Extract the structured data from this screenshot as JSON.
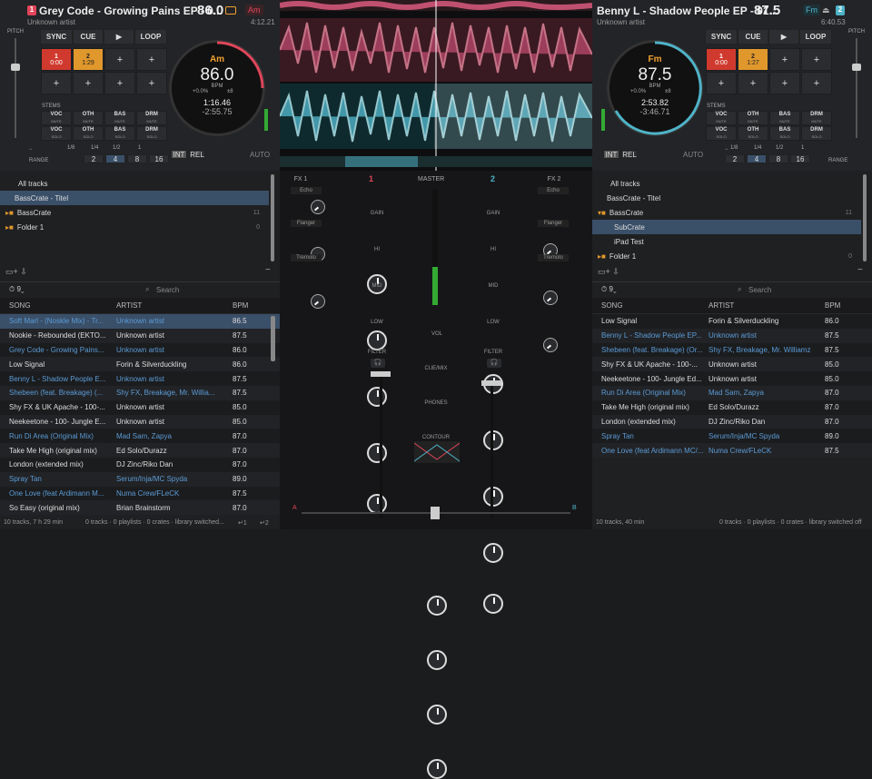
{
  "colors": {
    "left_accent": "#e0455a",
    "right_accent": "#4fb3c8",
    "key_orange": "#f0a030",
    "selection": "#3a4f68",
    "link_blue": "#5b9bd5",
    "pad_red": "#d03a2e",
    "pad_orange": "#e0982c"
  },
  "deck_left": {
    "num": "1",
    "title": "Grey Code - Growing Pains EP - 0...",
    "artist": "Unknown artist",
    "bpm": "86.0",
    "key": "Am",
    "duration": "4:12.21",
    "jog_key": "Am",
    "jog_bpm": "86.0",
    "jog_bpm_unit": "BPM",
    "jog_pitch": "+0.0%",
    "jog_range": "±8",
    "jog_elapsed": "1:16.46",
    "jog_remaining": "-2:55.75",
    "pitch_label": "PITCH",
    "sync": "SYNC",
    "cue": "CUE",
    "play": "▶",
    "loop": "LOOP",
    "hotcue1_num": "1",
    "hotcue1_time": "0:00",
    "hotcue2_num": "2",
    "hotcue2_time": "1:29",
    "plus": "+",
    "stems_label": "STEMS",
    "stems": [
      [
        "VOC",
        "MUTE"
      ],
      [
        "OTH",
        "MUTE"
      ],
      [
        "BAS",
        "MUTE"
      ],
      [
        "DRM",
        "MUTE"
      ],
      [
        "VOC",
        "SOLO"
      ],
      [
        "OTH",
        "SOLO"
      ],
      [
        "BAS",
        "SOLO"
      ],
      [
        "DRM",
        "SOLO"
      ]
    ],
    "loop_fracs": [
      "1/8",
      "1/4",
      "1/2",
      "1"
    ],
    "loop_vals": [
      "2",
      "4",
      "8",
      "16"
    ],
    "range": "RANGE",
    "int": "INT",
    "rel": "REL",
    "auto": "AUTO",
    "minus": "−"
  },
  "deck_right": {
    "num": "2",
    "title": "Benny L - Shadow People EP - 01...",
    "artist": "Unknown artist",
    "bpm": "87.5",
    "key": "Fm",
    "duration": "6:40.53",
    "jog_key": "Fm",
    "jog_bpm": "87.5",
    "jog_bpm_unit": "BPM",
    "jog_pitch": "+0.0%",
    "jog_range": "±8",
    "jog_elapsed": "2:53.82",
    "jog_remaining": "-3:46.71",
    "pitch_label": "PITCH",
    "sync": "SYNC",
    "cue": "CUE",
    "play": "▶",
    "loop": "LOOP",
    "hotcue1_num": "1",
    "hotcue1_time": "0:00",
    "hotcue2_num": "2",
    "hotcue2_time": "1:27",
    "plus": "+",
    "stems_label": "STEMS",
    "stems": [
      [
        "VOC",
        "MUTE"
      ],
      [
        "OTH",
        "MUTE"
      ],
      [
        "BAS",
        "MUTE"
      ],
      [
        "DRM",
        "MUTE"
      ],
      [
        "VOC",
        "SOLO"
      ],
      [
        "OTH",
        "SOLO"
      ],
      [
        "BAS",
        "SOLO"
      ],
      [
        "DRM",
        "SOLO"
      ]
    ],
    "loop_fracs": [
      "1/8",
      "1/4",
      "1/2",
      "1"
    ],
    "loop_vals": [
      "2",
      "4",
      "8",
      "16"
    ],
    "range": "RANGE",
    "int": "INT",
    "rel": "REL",
    "auto": "AUTO",
    "minus": "−"
  },
  "library_left": {
    "tree": [
      {
        "label": "All tracks",
        "count": ""
      },
      {
        "label": "BassCrate - Titel",
        "count": ""
      },
      {
        "label": "BassCrate",
        "count": "11"
      },
      {
        "label": "Folder 1",
        "count": "0"
      }
    ],
    "search_placeholder": "Search",
    "history_count": "9",
    "col_song": "SONG",
    "col_artist": "ARTIST",
    "col_bpm": "BPM",
    "rows": [
      [
        "Soft Marl - (Noskle Mix) - Tr...",
        "Unknown artist",
        "86.5"
      ],
      [
        "Nookie - Rebounded (EKTO...",
        "Unknown artist",
        "87.5"
      ],
      [
        "Grey Code - Growing Pains...",
        "Unknown artist",
        "86.0"
      ],
      [
        "Low Signal",
        "Forin & Silverduckling",
        "86.0"
      ],
      [
        "Benny L - Shadow People E...",
        "Unknown artist",
        "87.5"
      ],
      [
        "Shebeen (feat. Breakage) (...",
        "Shy FX, Breakage, Mr. Willia...",
        "87.5"
      ],
      [
        "Shy FX & UK Apache - 100-...",
        "Unknown artist",
        "85.0"
      ],
      [
        "Neekeetone - 100- Jungle E...",
        "Unknown artist",
        "85.0"
      ],
      [
        "Run Di Area (Original Mix)",
        "Mad Sam, Zapya",
        "87.0"
      ],
      [
        "Take Me High (original mix)",
        "Ed Solo/Durazz",
        "87.0"
      ],
      [
        "London (extended mix)",
        "DJ Zinc/Riko Dan",
        "87.0"
      ],
      [
        "Spray Tan",
        "Serum/Inja/MC Spyda",
        "89.0"
      ],
      [
        "One Love (feat Ardimann M...",
        "Numa Crew/FLeCK",
        "87.5"
      ],
      [
        "So Easy (original mix)",
        "Brian Brainstorm",
        "87.0"
      ]
    ],
    "status": "10 tracks, 7 h 29 min",
    "status2": "0 tracks · 0 playlists · 0 crates · library switched...",
    "deck1": "↵1",
    "deck2": "↵2"
  },
  "library_right": {
    "tree": [
      {
        "label": "All tracks",
        "count": ""
      },
      {
        "label": "BassCrate - Titel",
        "count": ""
      },
      {
        "label": "BassCrate",
        "count": "11"
      },
      {
        "label": "SubCrate",
        "count": ""
      },
      {
        "label": "iPad Test",
        "count": ""
      },
      {
        "label": "Folder 1",
        "count": "0"
      }
    ],
    "search_placeholder": "Search",
    "history_count": "9",
    "col_song": "SONG",
    "col_artist": "ARTIST",
    "col_bpm": "BPM",
    "rows": [
      [
        "Low Signal",
        "Forin & Silverduckling",
        "86.0"
      ],
      [
        "Benny L - Shadow People EP...",
        "Unknown artist",
        "87.5"
      ],
      [
        "Shebeen (feat. Breakage) (Or...",
        "Shy FX, Breakage, Mr. Williamz",
        "87.5"
      ],
      [
        "Shy FX & UK Apache - 100-...",
        "Unknown artist",
        "85.0"
      ],
      [
        "Neekeetone - 100- Jungle Ed...",
        "Unknown artist",
        "85.0"
      ],
      [
        "Run Di Area (Original Mix)",
        "Mad Sam, Zapya",
        "87.0"
      ],
      [
        "Take Me High (original mix)",
        "Ed Solo/Durazz",
        "87.0"
      ],
      [
        "London (extended mix)",
        "DJ Zinc/Riko Dan",
        "87.0"
      ],
      [
        "Spray Tan",
        "Serum/Inja/MC Spyda",
        "89.0"
      ],
      [
        "One Love (feat Ardimann MC/...",
        "Numa Crew/FLeCK",
        "87.5"
      ]
    ],
    "status": "10 tracks, 40 min",
    "status2": "0 tracks · 0 playlists · 0 crates · library switched off"
  },
  "mixer": {
    "fx1": "FX 1",
    "fx2": "FX 2",
    "ch1": "1",
    "ch2": "2",
    "master": "MASTER",
    "echo": "Echo",
    "flanger": "Flanger",
    "tremolo": "Tremolo",
    "gain": "GAIN",
    "hi": "HI",
    "mid": "MID",
    "low": "LOW",
    "filter": "FILTER",
    "vol": "VOL",
    "cuemix": "CUE/MIX",
    "phones": "PHONES",
    "contour": "CONTOUR",
    "xfade_a": "A",
    "xfade_b": "B"
  }
}
